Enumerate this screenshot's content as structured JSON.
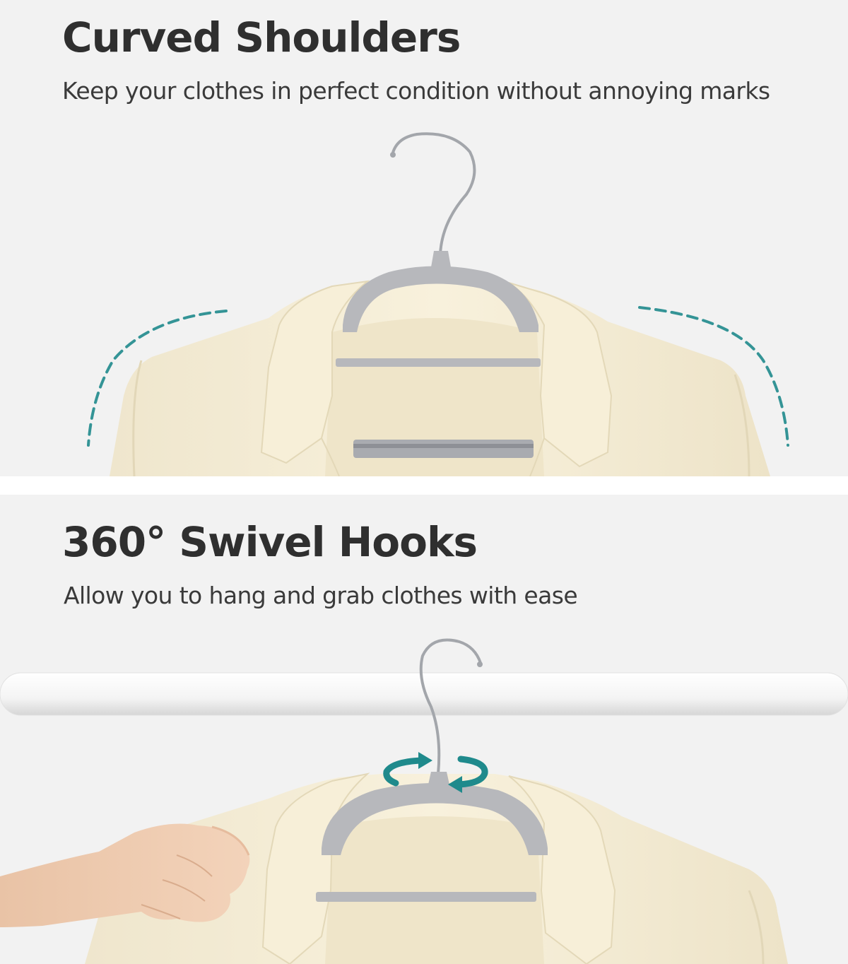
{
  "sections": [
    {
      "title": "Curved Shoulders",
      "subtitle": "Keep your clothes in perfect condition without annoying marks",
      "icons": [
        "dashed-curve-left-icon",
        "dashed-curve-right-icon"
      ]
    },
    {
      "title": "360° Swivel Hooks",
      "subtitle": "Allow you to hang and grab clothes with ease",
      "icons": [
        "rotate-arrows-icon"
      ]
    }
  ],
  "colors": {
    "background": "#f2f2f2",
    "heading": "#2f2f2f",
    "accent_teal": "#1f8a8c",
    "hanger_gray": "#b7b8bc",
    "garment_cream": "#f4ecd6",
    "hook_silver": "#9ea1a6"
  }
}
